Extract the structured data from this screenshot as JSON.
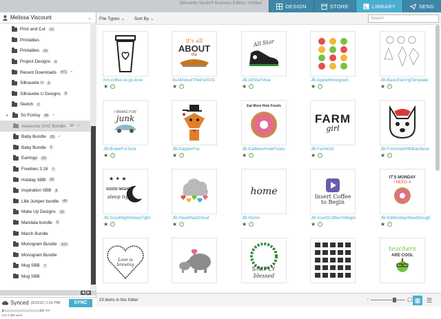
{
  "window": {
    "title": "Silhouette Studio® Business Edition: Untitled"
  },
  "nav": {
    "tabs": [
      {
        "label": "DESIGN",
        "icon": "design-icon",
        "active": false
      },
      {
        "label": "STORE",
        "icon": "store-icon",
        "active": false
      },
      {
        "label": "LIBRARY",
        "icon": "library-icon",
        "active": true
      },
      {
        "label": "SEND",
        "icon": "send-icon",
        "active": false
      }
    ]
  },
  "user": {
    "name": "Melissa Viscount"
  },
  "tree": [
    {
      "label": "Print and Cut",
      "count": "12"
    },
    {
      "label": "Printables",
      "count": ""
    },
    {
      "label": "Printables",
      "count": "16"
    },
    {
      "label": "Project Designs",
      "count": "4"
    },
    {
      "label": "Recent Downloads",
      "count": "471",
      "dot": true
    },
    {
      "label": "Silhouette U",
      "count": "3"
    },
    {
      "label": "Silhouette U Designs",
      "count": "8"
    },
    {
      "label": "Sketch",
      "count": "2"
    },
    {
      "label": "So Fontsy",
      "count": "46",
      "dot": true,
      "open": true
    },
    {
      "label": "Awesome SVG Bundle",
      "count": "33",
      "dot": true,
      "indent": 1,
      "selected": true
    },
    {
      "label": "Baby Bundle",
      "count": "28",
      "dot": true,
      "indent": 1
    },
    {
      "label": "Baby Bundle",
      "count": "1",
      "indent": 1
    },
    {
      "label": "Earrings",
      "count": "20",
      "indent": 1
    },
    {
      "label": "Freebies 3.16",
      "count": "7",
      "indent": 1
    },
    {
      "label": "Holiday SBB",
      "count": "25",
      "indent": 1
    },
    {
      "label": "Inspiration SBB",
      "count": "8",
      "indent": 1
    },
    {
      "label": "Lille Juniper bundle",
      "count": "40",
      "indent": 1
    },
    {
      "label": "Make Up Designs",
      "count": "16",
      "indent": 1
    },
    {
      "label": "Mandala bundle",
      "count": "5",
      "indent": 1
    },
    {
      "label": "March Bundle",
      "count": "",
      "indent": 1
    },
    {
      "label": "Monogram Bundle",
      "count": "101",
      "indent": 1
    },
    {
      "label": "Monogram Bundle",
      "count": "",
      "indent": 1
    },
    {
      "label": "Mug SBB",
      "count": "7",
      "indent": 1
    },
    {
      "label": "Mug SBB",
      "count": "",
      "indent": 1
    }
  ],
  "sync": {
    "status": "Synced",
    "date": "(5/13/19 | 1:01 PM)",
    "button": "SYNC",
    "used": "144.2 MB used",
    "total": "5.0 GB",
    "usage_fraction": 0.03
  },
  "toolbar": {
    "file_types": "File Types",
    "sort_by": "Sort By",
    "search_placeholder": "Search"
  },
  "items": [
    {
      "name": "hm-coffee-to-go-love"
    },
    {
      "name": "ItsAllAboutThePieSVG"
    },
    {
      "name": "JB-AllStarShoe"
    },
    {
      "name": "JB-AppleMonogram"
    },
    {
      "name": "JB-BasicEarringTemplate"
    },
    {
      "name": "JB-BrakeForJunk"
    },
    {
      "name": "JB-DapperFox"
    },
    {
      "name": "JB-EatMoreHoleFoods"
    },
    {
      "name": "JB-FarmGirl"
    },
    {
      "name": "JB-FrenchieWithBandana"
    },
    {
      "name": "JB-GoodNightSleepTight"
    },
    {
      "name": "JB-HeartRainCloud"
    },
    {
      "name": "JB-Home"
    },
    {
      "name": "JB-InsertCoffeeToBegin"
    },
    {
      "name": "JB-ItsMondayINeedDough"
    },
    {
      "name": ""
    },
    {
      "name": ""
    },
    {
      "name": ""
    },
    {
      "name": ""
    },
    {
      "name": ""
    }
  ],
  "art": {
    "pie1": "it's all",
    "pie2": "ABOUT",
    "pie3": "the",
    "allstar": "All Star",
    "brake1": "I BRAKE FOR",
    "brake2": "junk",
    "eat": "Eat More Hole Foods",
    "farm1": "FARM",
    "farm2": "girl",
    "good1": "GOOD NIGHT",
    "good2": "sleep tight",
    "home": "home",
    "insert1": "Insert Coffee",
    "insert2": "to Begin",
    "monday1": "IT'S MONDAY",
    "monday2": "I NEED A",
    "love": "Love is brewing",
    "simply1": "SIMPLY",
    "simply2": "blessed",
    "teach1": "teachers",
    "teach2": "ARE COOL"
  },
  "footer": {
    "count": "23 items in this folder"
  },
  "colors": {
    "accent": "#4aaed0",
    "nav": "#3d86a8",
    "link": "#46a9cc"
  }
}
